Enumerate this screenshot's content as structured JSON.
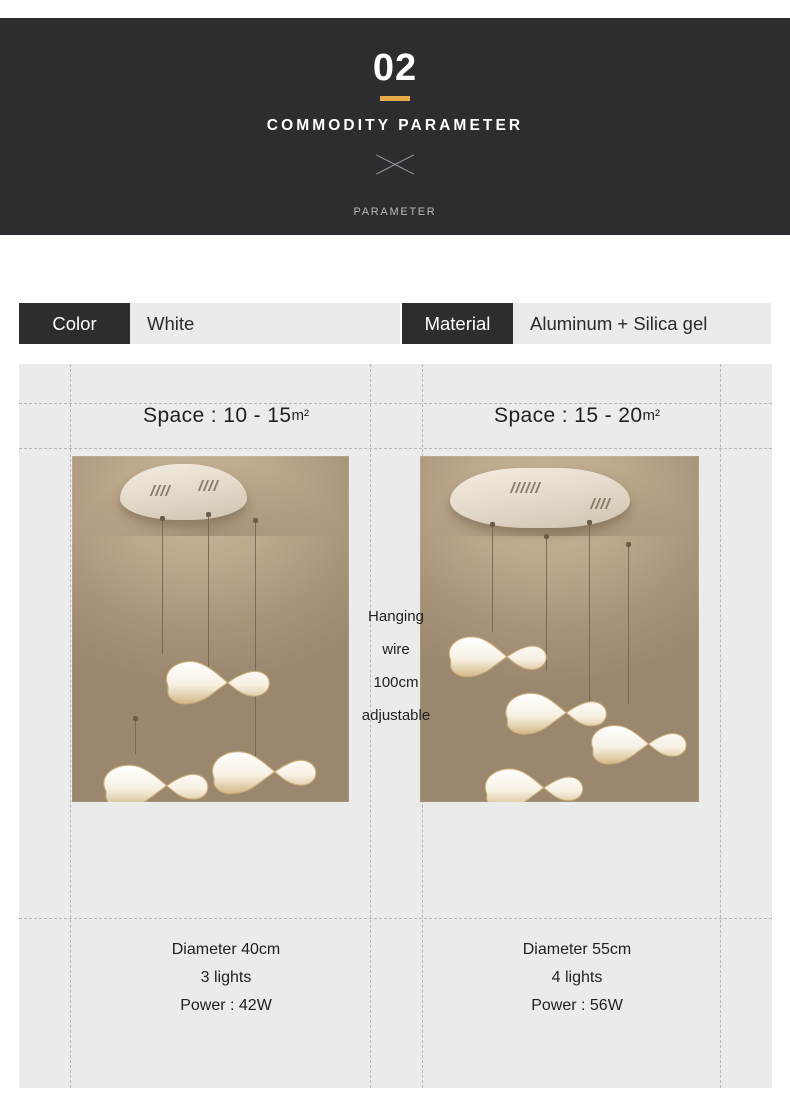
{
  "banner": {
    "number": "02",
    "title": "COMMODITY PARAMETER",
    "subtitle": "PARAMETER",
    "divider_icon": "x-divider-icon",
    "accent_color": "#e8a948",
    "background_color": "#2c2d31"
  },
  "spec_table": {
    "rows": [
      {
        "label": "Color",
        "value": "White"
      },
      {
        "label": "Material",
        "value": "Aluminum + Silica gel"
      }
    ],
    "label_background": "#2c2d31",
    "value_background": "#ebebeb"
  },
  "hanging_note": {
    "line1": "Hanging",
    "line2": "wire",
    "line3": "100cm",
    "line4": "adjustable"
  },
  "variants": [
    {
      "space_prefix": "Space : 10  - 15",
      "space_unit": "m²",
      "image_alt": "pendant-lamp-3-lights",
      "diameter": "Diameter 40cm",
      "lights": "3 lights",
      "power": "Power : 42W"
    },
    {
      "space_prefix": "Space : 15 - 20",
      "space_unit": "m²",
      "image_alt": "pendant-lamp-4-lights",
      "diameter": "Diameter 55cm",
      "lights": "4 lights",
      "power": "Power : 56W"
    }
  ],
  "panel": {
    "background_color": "#ebebeb",
    "guide_line_color": "#b6b6b6"
  }
}
